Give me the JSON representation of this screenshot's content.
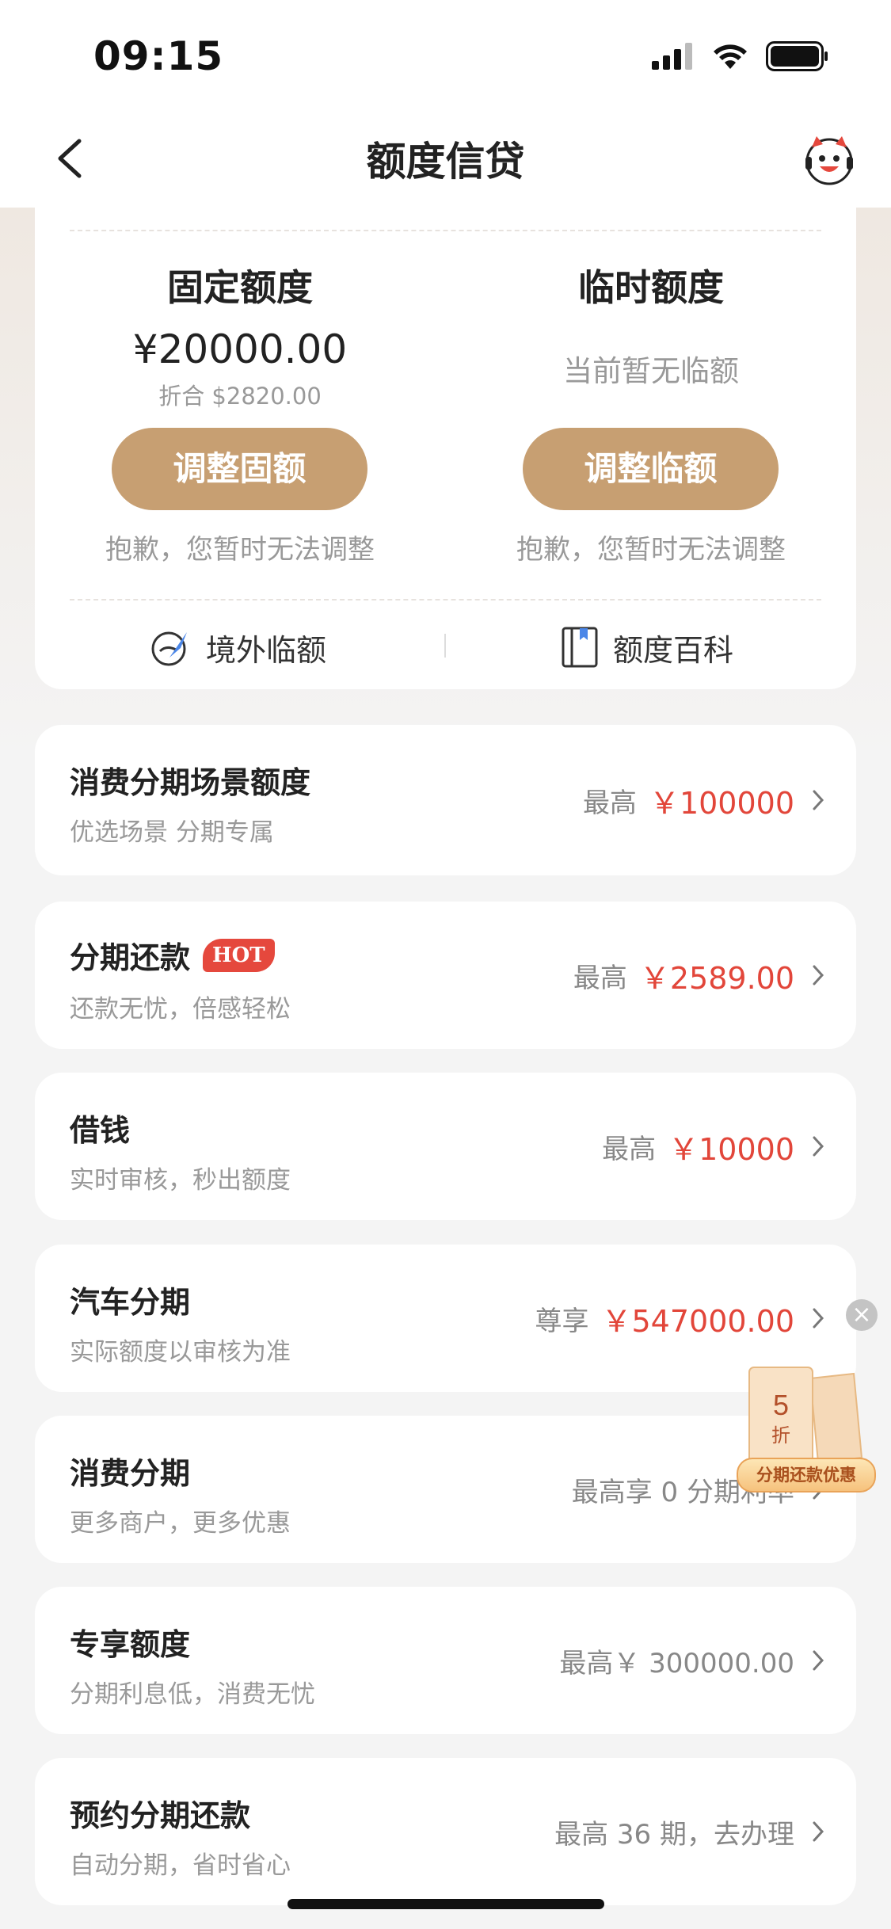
{
  "status_bar": {
    "time": "09:15"
  },
  "nav": {
    "title": "额度信贷"
  },
  "limit_card": {
    "fixed": {
      "title": "固定额度",
      "amount": "¥20000.00",
      "converted": "折合 $2820.00",
      "button": "调整固额",
      "tip": "抱歉，您暂时无法调整"
    },
    "temp": {
      "title": "临时额度",
      "status": "当前暂无临额",
      "button": "调整临额",
      "tip": "抱歉，您暂时无法调整"
    },
    "links": {
      "overseas": "境外临额",
      "wiki": "额度百科"
    }
  },
  "rows": [
    {
      "title": "消费分期场景额度",
      "subtitle": "优选场景 分期专属",
      "prefix": "最高",
      "value": "￥100000",
      "highlight": true
    },
    {
      "title": "分期还款",
      "badge": "HOT",
      "subtitle": "还款无忧，倍感轻松",
      "prefix": "最高",
      "value": "￥2589.00",
      "highlight": true
    },
    {
      "title": "借钱",
      "subtitle": "实时审核，秒出额度",
      "prefix": "最高",
      "value": "￥10000",
      "highlight": true
    },
    {
      "title": "汽车分期",
      "subtitle": "实际额度以审核为准",
      "prefix": "尊享",
      "value": "￥547000.00",
      "highlight": true
    },
    {
      "title": "消费分期",
      "subtitle": "更多商户，更多优惠",
      "prefix": "",
      "value": "最高享 0 分期利率",
      "highlight": false
    },
    {
      "title": "专享额度",
      "subtitle": "分期利息低，消费无忧",
      "prefix": "",
      "value": "最高￥ 300000.00",
      "highlight": false
    },
    {
      "title": "预约分期还款",
      "subtitle": "自动分期，省时省心",
      "prefix": "",
      "value": "最高 36 期，去办理",
      "highlight": false
    }
  ],
  "float_promo": {
    "discount": "5",
    "discount_unit": "折",
    "label": "分期还款优惠"
  },
  "colors": {
    "accent": "#c79f72",
    "red": "#e2463a",
    "hot": "#e5483d"
  }
}
